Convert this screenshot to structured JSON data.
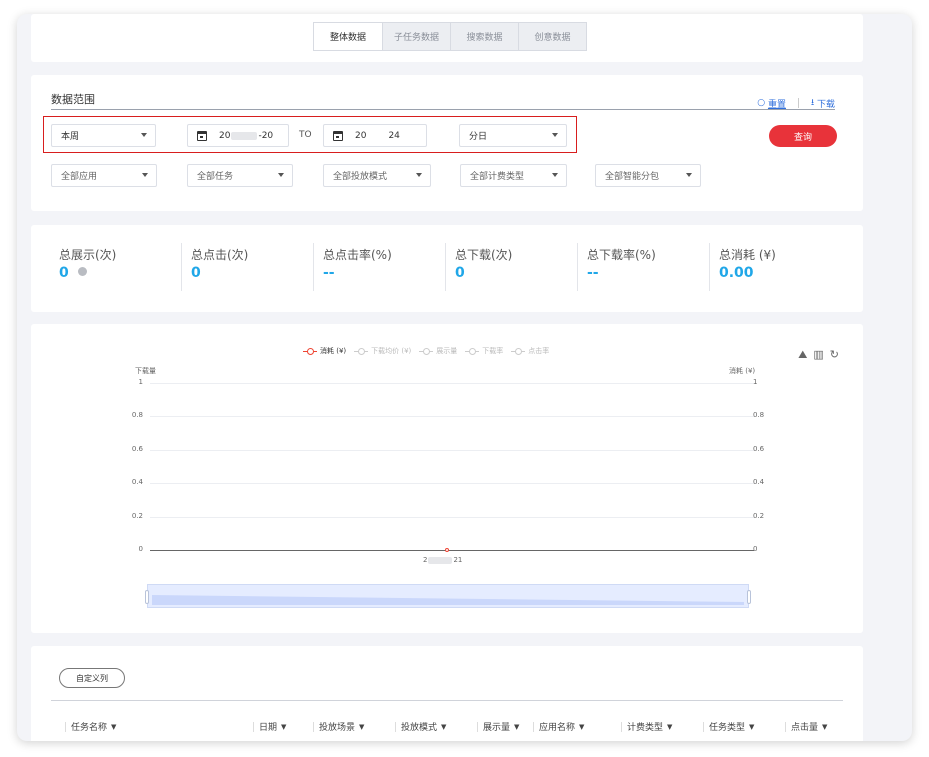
{
  "tabs": [
    "整体数据",
    "子任务数据",
    "搜索数据",
    "创意数据"
  ],
  "filter": {
    "title": "数据范围",
    "reset": "重置",
    "download": "下载",
    "period": "本周",
    "date_start_a": "20",
    "date_start_b": "-20",
    "to": "TO",
    "date_end_a": "20",
    "date_end_b": "24",
    "granularity": "分日",
    "query": "查询",
    "dropdowns": [
      "全部应用",
      "全部任务",
      "全部投放模式",
      "全部计费类型",
      "全部智能分包"
    ]
  },
  "stats": [
    {
      "label": "总展示(次)",
      "value": "0"
    },
    {
      "label": "总点击(次)",
      "value": "0"
    },
    {
      "label": "总点击率(%)",
      "value": "--"
    },
    {
      "label": "总下载(次)",
      "value": "0"
    },
    {
      "label": "总下载率(%)",
      "value": "--"
    },
    {
      "label": "总消耗 (¥)",
      "value": "0.00"
    }
  ],
  "chart_data": {
    "type": "line",
    "legend": [
      "消耗 (¥)",
      "下载均价 (¥)",
      "展示量",
      "下载率",
      "点击率"
    ],
    "active_series": "消耗 (¥)",
    "ylabel_left": "下载量",
    "ylabel_right": "消耗 (¥)",
    "yticks": [
      "1",
      "0.8",
      "0.6",
      "0.4",
      "0.2",
      "0"
    ],
    "ylim": [
      0,
      1
    ],
    "x_label_a": "2",
    "x_label_b": "21",
    "series": [
      {
        "name": "消耗 (¥)",
        "values": [
          0
        ]
      }
    ],
    "legend_position": "top"
  },
  "table": {
    "customize": "自定义列",
    "headers": [
      "任务名称",
      "日期",
      "投放场景",
      "投放模式",
      "展示量",
      "应用名称",
      "计费类型",
      "任务类型",
      "点击量"
    ]
  }
}
